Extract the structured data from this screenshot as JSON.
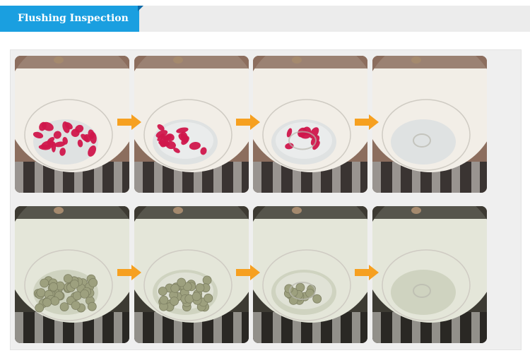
{
  "header": {
    "title": "Flushing Inspection"
  },
  "colors": {
    "accent": "#1a9fe0",
    "arrow": "#f6a020",
    "bowl": "#f4f1ea",
    "petals": "#d0174c",
    "beads": "#9da07e"
  },
  "sequences": [
    {
      "name": "rose-petals",
      "stages": [
        {
          "level": 1.0
        },
        {
          "level": 0.7
        },
        {
          "level": 0.35
        },
        {
          "level": 0.0
        }
      ]
    },
    {
      "name": "gel-beads",
      "stages": [
        {
          "level": 1.0
        },
        {
          "level": 0.75
        },
        {
          "level": 0.3
        },
        {
          "level": 0.0
        }
      ]
    }
  ]
}
